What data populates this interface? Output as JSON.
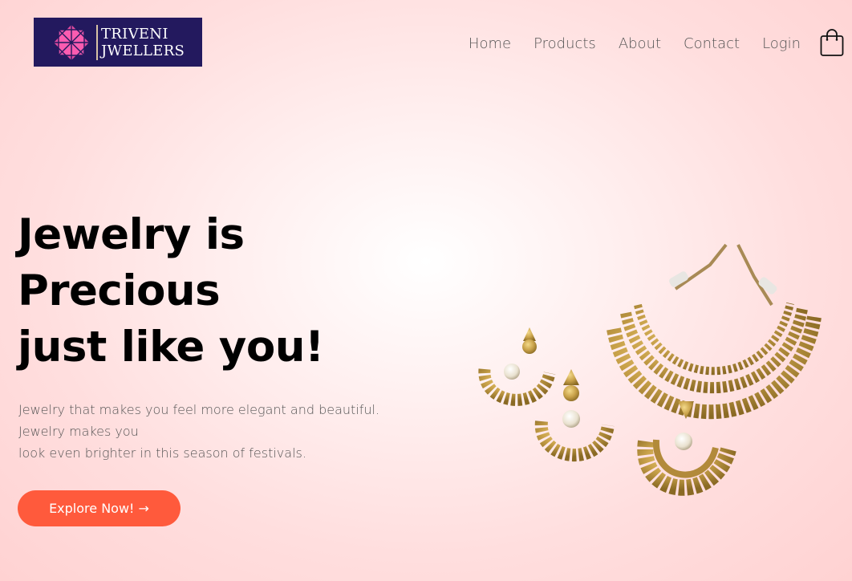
{
  "brand": {
    "line1": "TRIVENI",
    "line2": "JWELLERS",
    "logo_color": "#23195e"
  },
  "nav": {
    "items": [
      {
        "label": "Home"
      },
      {
        "label": "Products"
      },
      {
        "label": "About"
      },
      {
        "label": "Contact"
      },
      {
        "label": "Login"
      }
    ],
    "cart_icon": "shopping-bag-icon"
  },
  "hero": {
    "title_line1": "Jewelry is",
    "title_line2": "Precious",
    "title_line3": "just like you!",
    "desc_line1": "Jewelry that makes you feel more elegant and beautiful.",
    "desc_line2": "Jewelry makes you",
    "desc_line3": "look even brighter in this season of festivals.",
    "cta_label": "Explore Now! →",
    "cta_color": "#ff5a3c"
  },
  "image": {
    "subject": "gold-necklace-earrings-set"
  }
}
